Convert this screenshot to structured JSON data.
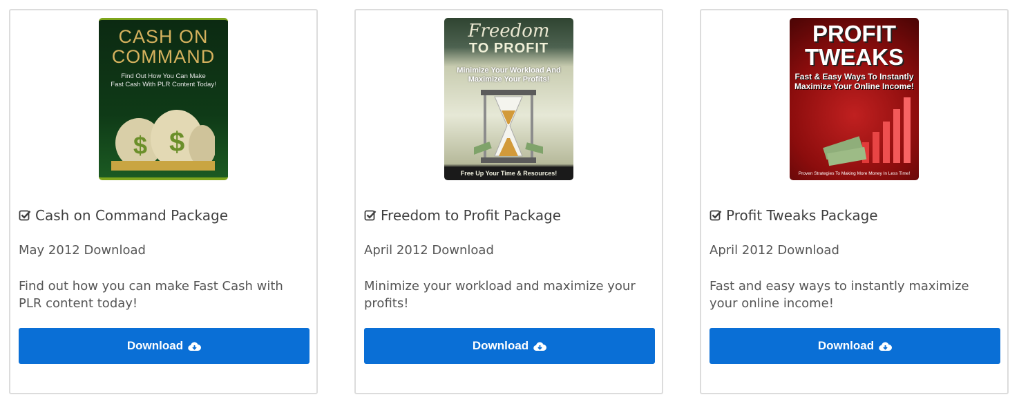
{
  "products": [
    {
      "cover": {
        "lines_big": [
          "CASH ON",
          "COMMAND"
        ],
        "lines_small": [
          "Find Out How You Can Make",
          "Fast Cash With PLR Content Today!"
        ]
      },
      "title": "Cash on Command Package",
      "date": "May 2012 Download",
      "description": "Find out how you can make Fast Cash with PLR content today!",
      "button_label": "Download"
    },
    {
      "cover": {
        "script": "Freedom",
        "headline": "TO PROFIT",
        "lines_small": [
          "Minimize Your Workload And",
          "Maximize Your Profits!"
        ],
        "bottom": "Free Up Your Time & Resources!"
      },
      "title": "Freedom to Profit Package",
      "date": "April 2012 Download",
      "description": "Minimize your workload and maximize your profits!",
      "button_label": "Download"
    },
    {
      "cover": {
        "lines_big": [
          "PROFIT",
          "TWEAKS"
        ],
        "lines_small": [
          "Fast & Easy Ways To Instantly",
          "Maximize Your Online Income!"
        ],
        "bottom": "Proven Strategies To Making More Money In Less Time!"
      },
      "title": "Profit Tweaks Package",
      "date": "April 2012 Download",
      "description": "Fast and easy ways to instantly maximize your online income!",
      "button_label": "Download"
    }
  ],
  "colors": {
    "button": "#0a6fd6",
    "border": "#dcdcdc",
    "text": "#444444"
  },
  "icons": {
    "title_icon": "check-square-icon",
    "button_icon": "cloud-download-icon"
  }
}
